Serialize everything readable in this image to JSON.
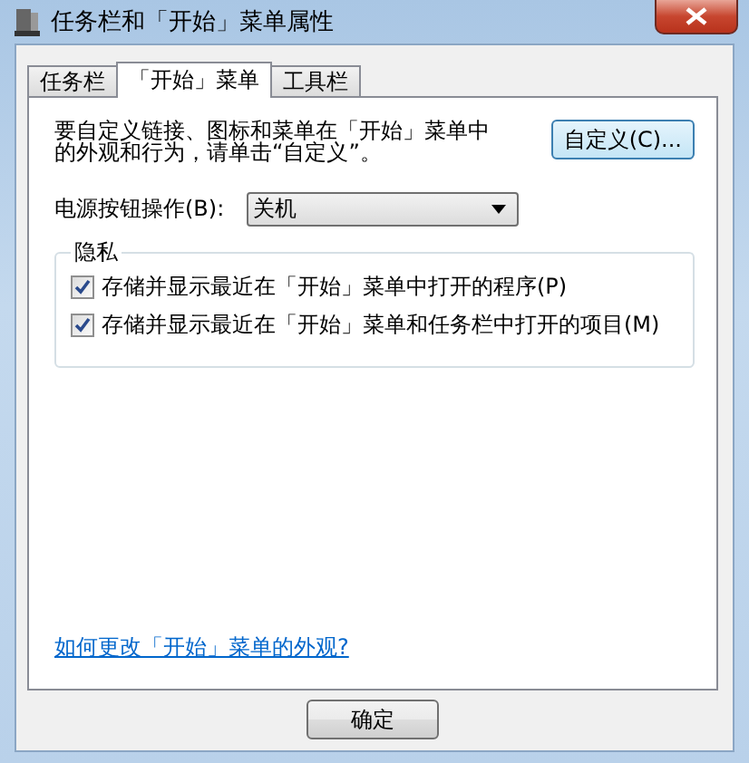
{
  "window": {
    "title": "任务栏和「开始」菜单属性"
  },
  "tabs": [
    {
      "label": "任务栏",
      "selected": false
    },
    {
      "label": "「开始」菜单",
      "selected": true
    },
    {
      "label": "工具栏",
      "selected": false
    }
  ],
  "intro": "要自定义链接、图标和菜单在「开始」菜单中的外观和行为，请单击“自定义”。",
  "customize_button": "自定义(C)...",
  "power_button": {
    "label": "电源按钮操作(B):",
    "value": "关机"
  },
  "privacy": {
    "title": "隐私",
    "options": [
      {
        "label": "存储并显示最近在「开始」菜单中打开的程序(P)",
        "checked": true
      },
      {
        "label": "存储并显示最近在「开始」菜单和任务栏中打开的项目(M)",
        "checked": true
      }
    ]
  },
  "help_link": "如何更改「开始」菜单的外观?",
  "buttons": [
    "确定"
  ]
}
